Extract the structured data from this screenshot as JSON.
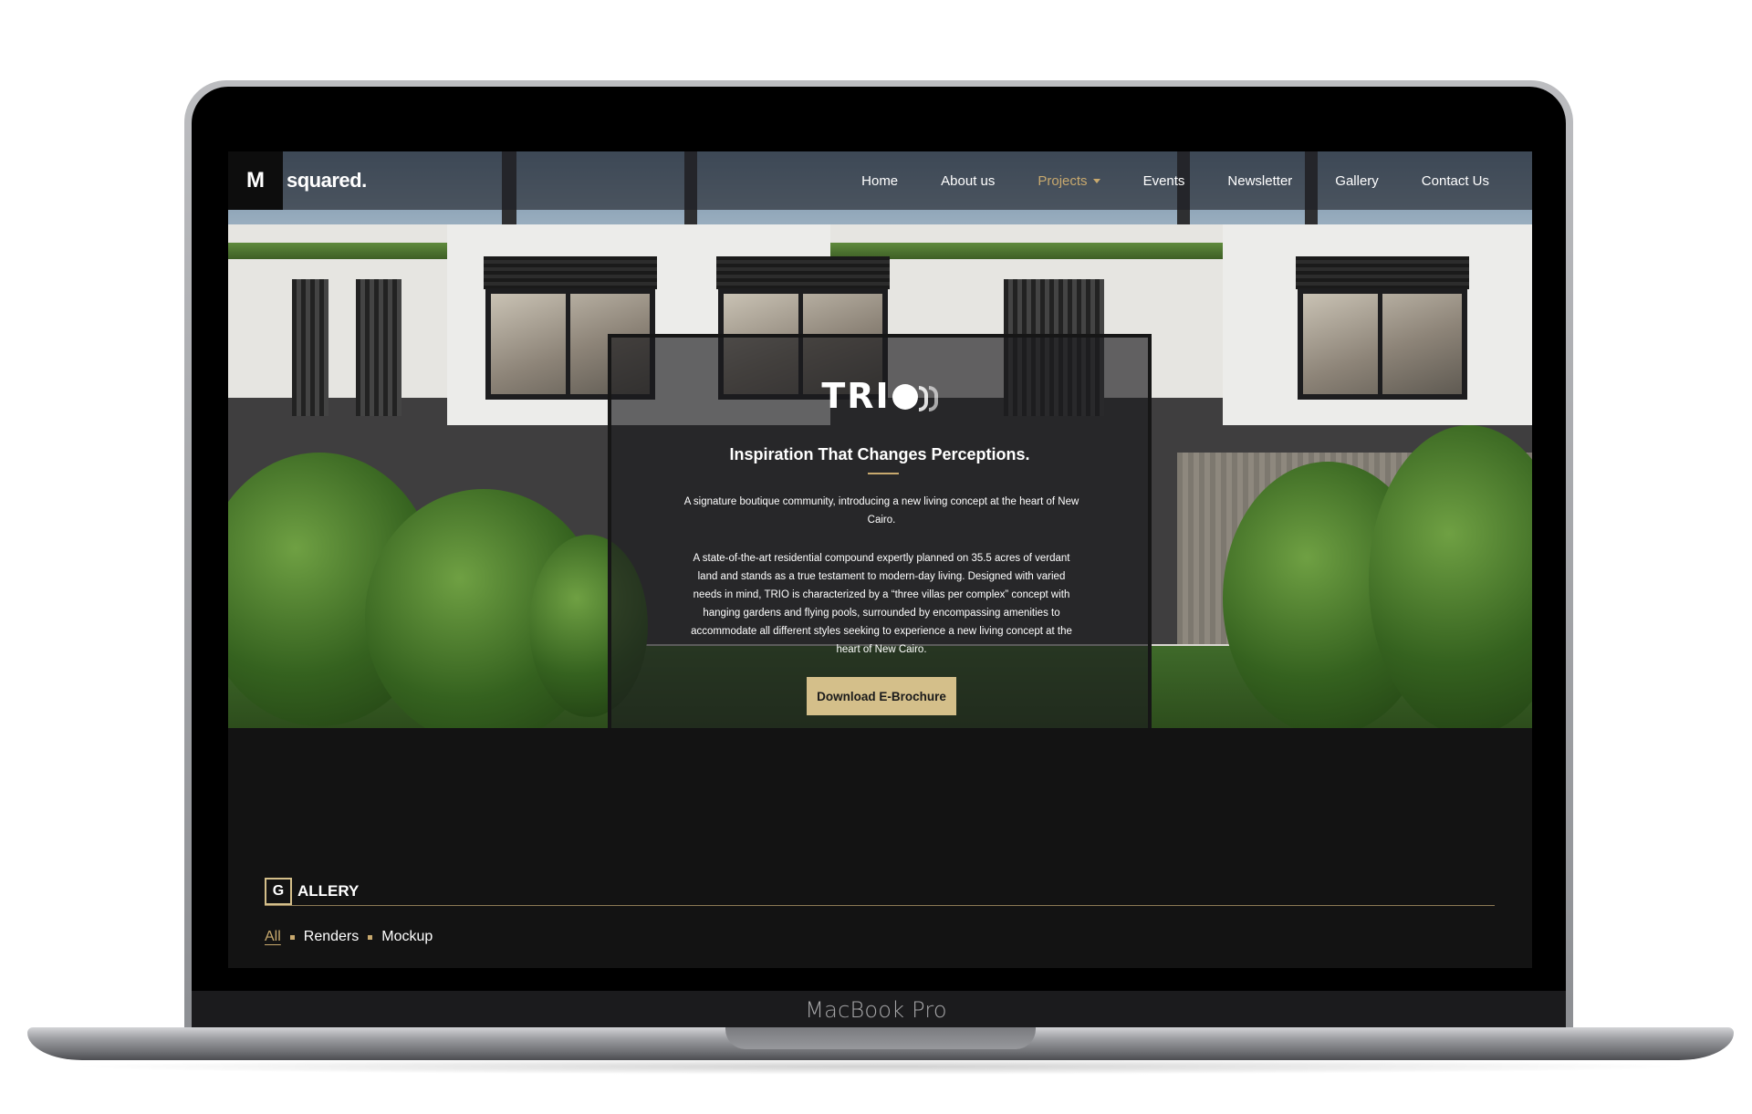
{
  "device": {
    "label": "MacBook Pro"
  },
  "site": {
    "logo_mark": "M",
    "logo_word": "squared.",
    "nav": [
      {
        "label": "Home"
      },
      {
        "label": "About us"
      },
      {
        "label": "Projects"
      },
      {
        "label": "Events"
      },
      {
        "label": "Newsletter"
      },
      {
        "label": "Gallery"
      },
      {
        "label": "Contact Us"
      }
    ],
    "nav_active": "Projects",
    "accent_color": "#c8a96e"
  },
  "hero": {
    "brand": "TRI",
    "tagline": "Inspiration That Changes Perceptions.",
    "description_1": "A signature boutique community, introducing a new living concept at the heart of New Cairo.",
    "description_2": "A state-of-the-art residential compound expertly planned on 35.5 acres of verdant land and stands as a true testament to modern-day living. Designed with varied needs in mind, TRIO is characterized by a “three villas per complex” concept with hanging gardens and flying pools, surrounded by encompassing amenities to accommodate all different styles seeking to experience a new living concept at the heart of New Cairo.",
    "cta_label": "Download E-Brochure"
  },
  "gallery": {
    "heading_initial": "G",
    "heading_rest": "ALLERY",
    "filters": [
      {
        "label": "All"
      },
      {
        "label": "Renders"
      },
      {
        "label": "Mockup"
      }
    ],
    "active_filter": "All"
  }
}
